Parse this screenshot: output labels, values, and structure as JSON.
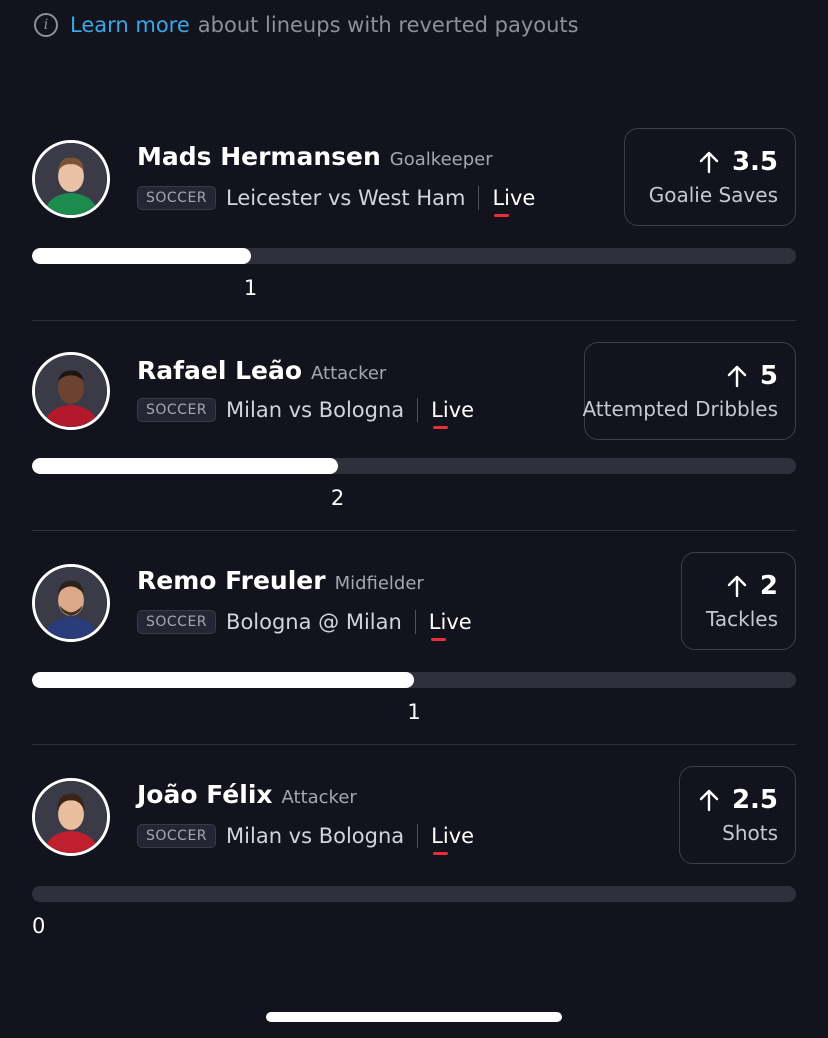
{
  "info": {
    "icon": "info-icon",
    "link_text": "Learn more",
    "text": "about lineups with reverted payouts"
  },
  "picks": [
    {
      "name": "Mads Hermansen",
      "position": "Goalkeeper",
      "sport": "SOCCER",
      "matchup": "Leicester vs West Ham",
      "status": "Live",
      "line": "3.5",
      "stat": "Goalie Saves",
      "current": "1",
      "progress": 0.286,
      "jersey_color": "#1d8a4e"
    },
    {
      "name": "Rafael Leão",
      "position": "Attacker",
      "sport": "SOCCER",
      "matchup": "Milan vs Bologna",
      "status": "Live",
      "line": "5",
      "stat": "Attempted Dribbles",
      "current": "2",
      "progress": 0.4,
      "jersey_color": "#b3192b"
    },
    {
      "name": "Remo Freuler",
      "position": "Midfielder",
      "sport": "SOCCER",
      "matchup": "Bologna @ Milan",
      "status": "Live",
      "line": "2",
      "stat": "Tackles",
      "current": "1",
      "progress": 0.5,
      "jersey_color": "#2a3d7a"
    },
    {
      "name": "João Félix",
      "position": "Attacker",
      "sport": "SOCCER",
      "matchup": "Milan vs Bologna",
      "status": "Live",
      "line": "2.5",
      "stat": "Shots",
      "current": "0",
      "progress": 0,
      "jersey_color": "#c0202e"
    }
  ],
  "colors": {
    "background": "#12131c",
    "link": "#3ba7e8",
    "live_underline": "#e5303c",
    "progress_fill": "#ffffff",
    "progress_track": "#2f303c"
  }
}
